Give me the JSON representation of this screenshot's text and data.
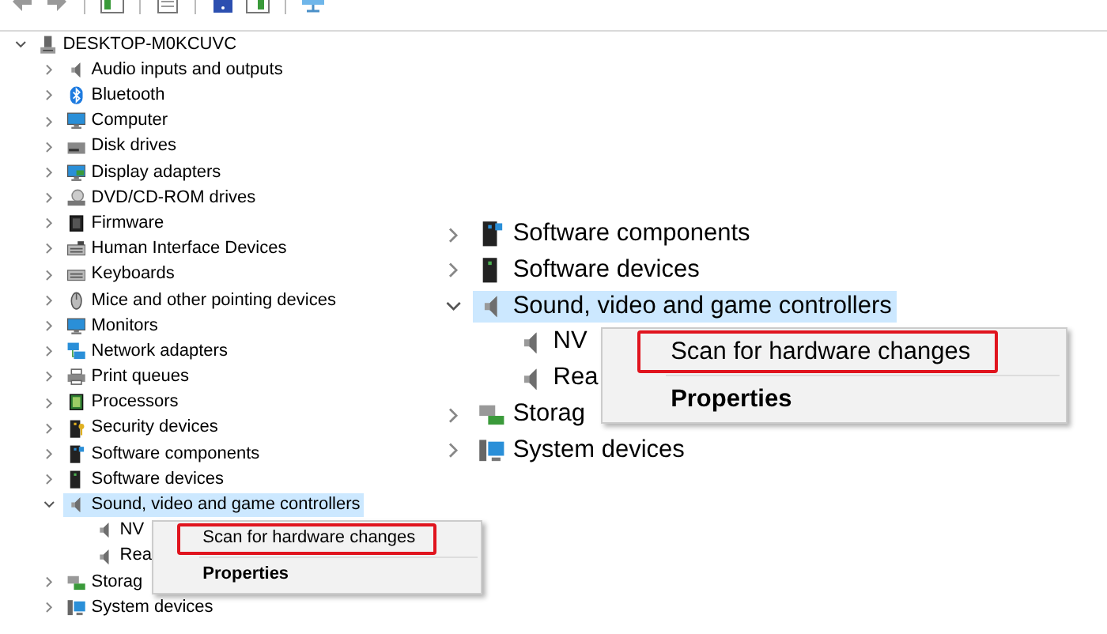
{
  "tree": {
    "label": "DESKTOP-M0KCUVC",
    "kind": "computer",
    "expanded": true,
    "selected": false,
    "children": [
      {
        "label": "Audio inputs and outputs",
        "kind": "speaker",
        "expanded": false,
        "selected": false
      },
      {
        "label": "Bluetooth",
        "kind": "bluetooth",
        "expanded": false,
        "selected": false
      },
      {
        "label": "Computer",
        "kind": "monitor",
        "expanded": false,
        "selected": false
      },
      {
        "label": "Disk drives",
        "kind": "disk",
        "expanded": false,
        "selected": false
      },
      {
        "label": "Display adapters",
        "kind": "display",
        "expanded": false,
        "selected": false
      },
      {
        "label": "DVD/CD-ROM drives",
        "kind": "dvd",
        "expanded": false,
        "selected": false
      },
      {
        "label": "Firmware",
        "kind": "chip",
        "expanded": false,
        "selected": false
      },
      {
        "label": "Human Interface Devices",
        "kind": "hid",
        "expanded": false,
        "selected": false
      },
      {
        "label": "Keyboards",
        "kind": "keyboard",
        "expanded": false,
        "selected": false
      },
      {
        "label": "Mice and other pointing devices",
        "kind": "mouse",
        "expanded": false,
        "selected": false
      },
      {
        "label": "Monitors",
        "kind": "monitor",
        "expanded": false,
        "selected": false
      },
      {
        "label": "Network adapters",
        "kind": "network",
        "expanded": false,
        "selected": false
      },
      {
        "label": "Print queues",
        "kind": "printer",
        "expanded": false,
        "selected": false
      },
      {
        "label": "Processors",
        "kind": "processor",
        "expanded": false,
        "selected": false
      },
      {
        "label": "Security devices",
        "kind": "security",
        "expanded": false,
        "selected": false
      },
      {
        "label": "Software components",
        "kind": "component",
        "expanded": false,
        "selected": false
      },
      {
        "label": "Software devices",
        "kind": "device",
        "expanded": false,
        "selected": false
      },
      {
        "label": "Sound, video and game controllers",
        "kind": "speaker",
        "expanded": true,
        "selected": true,
        "children": [
          {
            "label": "NV",
            "kind": "speaker",
            "selected": false
          },
          {
            "label": "Rea",
            "kind": "speaker",
            "selected": false
          }
        ]
      },
      {
        "label": "Storag",
        "kind": "storage",
        "expanded": false,
        "selected": false
      },
      {
        "label": "System devices",
        "kind": "system",
        "expanded": false,
        "selected": false
      }
    ]
  },
  "context_menu": {
    "items": [
      {
        "label": "Scan for hardware changes",
        "default": false,
        "annotated": true
      },
      {
        "label": "Properties",
        "default": true,
        "annotated": false
      }
    ]
  },
  "zoom_inset": {
    "items": [
      {
        "label": "Software components",
        "kind": "component",
        "expanded": false,
        "selected": false
      },
      {
        "label": "Software devices",
        "kind": "device",
        "expanded": false,
        "selected": false
      },
      {
        "label": "Sound, video and game controllers",
        "kind": "speaker",
        "expanded": true,
        "selected": true,
        "children": [
          {
            "label": "NV",
            "kind": "speaker",
            "selected": false
          },
          {
            "label": "Rea",
            "kind": "speaker",
            "selected": false
          }
        ]
      },
      {
        "label": "Storag",
        "kind": "storage",
        "expanded": false,
        "selected": false
      },
      {
        "label": "System devices",
        "kind": "system",
        "expanded": false,
        "selected": false
      }
    ],
    "context_menu": {
      "items": [
        {
          "label": "Scan for hardware changes",
          "default": false,
          "annotated": true
        },
        {
          "label": "Properties",
          "default": true,
          "annotated": false
        }
      ]
    }
  }
}
